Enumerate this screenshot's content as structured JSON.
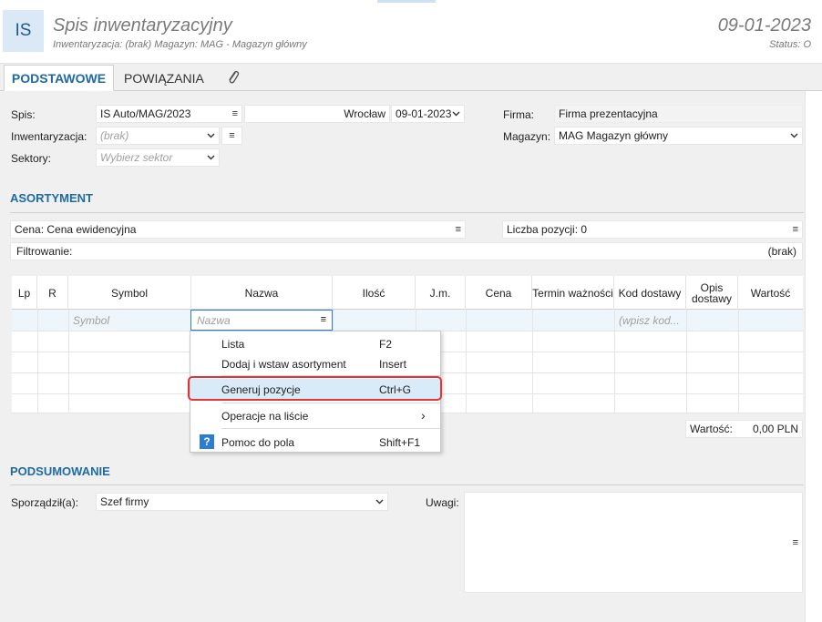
{
  "header": {
    "badge": "IS",
    "title": "Spis inwentaryzacyjny",
    "subtitle": "Inwentaryzacja: (brak)  Magazyn: MAG - Magazyn główny",
    "date": "09-01-2023",
    "status": "Status: O"
  },
  "tabs": {
    "podstawowe": "PODSTAWOWE",
    "powiazania": "POWIĄZANIA"
  },
  "form": {
    "spis_label": "Spis:",
    "spis_value": "IS Auto/MAG/2023",
    "place_label": "Wrocław",
    "spis_date": "09-01-2023",
    "firma_label": "Firma:",
    "firma_value": "Firma prezentacyjna",
    "inwent_label": "Inwentaryzacja:",
    "inwent_value": "(brak)",
    "magazyn_label": "Magazyn:",
    "magazyn_value": "MAG  Magazyn główny",
    "sektory_label": "Sektory:",
    "sektory_placeholder": "Wybierz sektor"
  },
  "asortyment": {
    "title": "ASORTYMENT",
    "cena": "Cena: Cena ewidencyjna",
    "liczba": "Liczba pozycji: 0",
    "filtr_label": "Filtrowanie:",
    "filtr_value": "(brak)"
  },
  "table": {
    "columns": [
      "Lp",
      "R",
      "Symbol",
      "Nazwa",
      "Ilość",
      "J.m.",
      "Cena",
      "Termin ważności",
      "Kod dostawy",
      "Opis dostawy",
      "Wartość"
    ],
    "symbol_placeholder": "Symbol",
    "nazwa_placeholder": "Nazwa",
    "kod_placeholder": "(wpisz kod..."
  },
  "total": {
    "label": "Wartość:",
    "value": "0,00 PLN"
  },
  "context_menu": {
    "items": [
      {
        "label": "Lista",
        "shortcut": "F2"
      },
      {
        "label": "Dodaj i wstaw asortyment",
        "shortcut": "Insert"
      },
      {
        "label": "Generuj pozycje",
        "shortcut": "Ctrl+G"
      },
      {
        "label": "Operacje na liście",
        "shortcut": "›"
      },
      {
        "label": "Pomoc do pola",
        "shortcut": "Shift+F1"
      }
    ],
    "help_glyph": "?"
  },
  "podsumowanie": {
    "title": "PODSUMOWANIE",
    "sporzadzil_label": "Sporządził(a):",
    "sporzadzil_value": "Szef firmy",
    "uwagi_label": "Uwagi:"
  },
  "icons": {
    "menu": "≡",
    "paperclip": "paperclip-icon",
    "chevron": "chevron-down-icon"
  }
}
